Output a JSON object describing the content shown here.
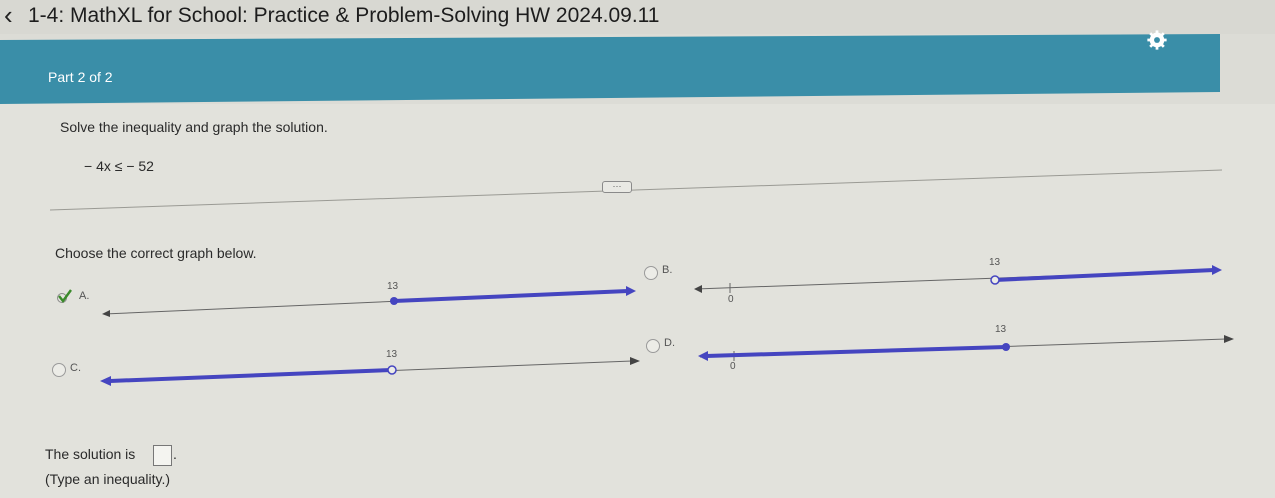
{
  "app": {
    "title": "1-4: MathXL for School: Practice & Problem-Solving HW 2024.09.11",
    "back_icon": "chevron-left-icon",
    "settings_icon": "gear-icon",
    "header_color": "#3a8ea8"
  },
  "header": {
    "part_label": "Part 2 of 2"
  },
  "question": {
    "instruction": "Solve the inequality and graph the solution.",
    "inequality": "− 4x ≤ − 52",
    "more_label": "···"
  },
  "choices": {
    "prompt": "Choose the correct graph below.",
    "selected": "A",
    "line_color": "#4545c0",
    "options": [
      {
        "letter": "A.",
        "tick": "13",
        "point": "closed",
        "direction": "right"
      },
      {
        "letter": "B.",
        "tick": "13",
        "zero": "0",
        "point": "open",
        "direction": "right"
      },
      {
        "letter": "C.",
        "tick": "13",
        "point": "open",
        "direction": "left"
      },
      {
        "letter": "D.",
        "tick": "13",
        "zero": "0",
        "point": "closed",
        "direction": "left"
      }
    ]
  },
  "answer": {
    "prefix": "The solution is",
    "value": "",
    "suffix": ".",
    "hint": "(Type an inequality.)"
  }
}
